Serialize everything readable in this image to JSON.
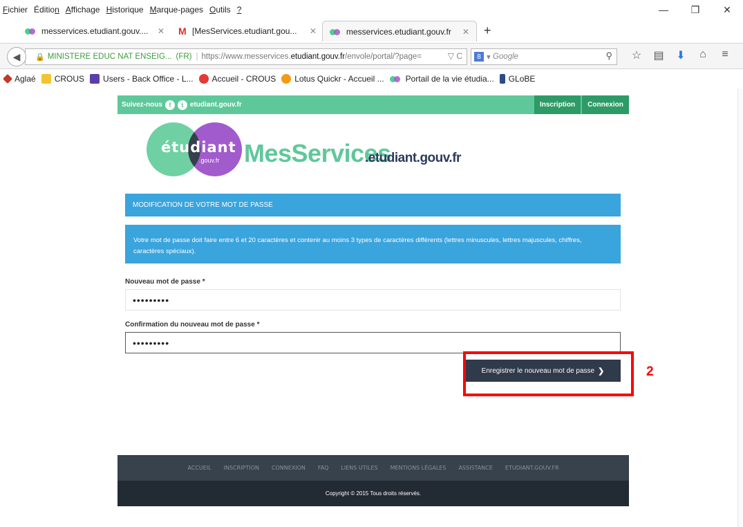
{
  "menu": {
    "items": [
      {
        "accel": "F",
        "rest": "ichier"
      },
      {
        "accel": "",
        "rest": "Éditio",
        "accel2": "n"
      },
      {
        "accel": "A",
        "rest": "ffichage"
      },
      {
        "accel": "H",
        "rest": "istorique"
      },
      {
        "accel": "M",
        "rest": "arque-pages"
      },
      {
        "accel": "O",
        "rest": "utils"
      },
      {
        "accel": "?",
        "rest": ""
      }
    ]
  },
  "window": {
    "minimize": "—",
    "restore": "❐",
    "close": "✕"
  },
  "tabs": [
    {
      "title": "messervices.etudiant.gouv...."
    },
    {
      "title": "[MesServices.etudiant.gou..."
    },
    {
      "title": "messervices.etudiant.gouv.fr"
    }
  ],
  "newtab": "+",
  "urlbar": {
    "org": "MINISTERE EDUC NAT ENSEIG...",
    "country": "(FR)",
    "prefix": "https://www.messervices.",
    "host": "etudiant.gouv.fr",
    "path": "/envole/portal/?page=",
    "end": "▽ C"
  },
  "search": {
    "badge": "8",
    "placeholder": "Google"
  },
  "bookmarks": [
    {
      "label": "Aglaé"
    },
    {
      "label": "CROUS"
    },
    {
      "label": "Users - Back Office - L..."
    },
    {
      "label": "Accueil - CROUS"
    },
    {
      "label": "Lotus Quickr - Accueil ..."
    },
    {
      "label": "Portail de la vie étudia..."
    },
    {
      "label": "GLoBE"
    }
  ],
  "site": {
    "follow": "Suivez-nous",
    "domain": "etudiant.gouv.fr",
    "signup": "Inscription",
    "login": "Connexion",
    "logo_word": "étudiant",
    "logo_sub": ".gouv.fr",
    "brand": "MesServices",
    "brand_domain": ".etudiant.gouv.fr"
  },
  "form": {
    "heading": "MODIFICATION DE VOTRE MOT DE PASSE",
    "info": "Votre mot de passe doit faire entre 6 et 20 caractères et contenir au moins 3 types de caractères différents (lettres minuscules, lettres majuscules, chiffres, caractères spéciaux).",
    "new_label": "Nouveau mot de passe *",
    "new_value": "•••••••••",
    "confirm_label": "Confirmation du nouveau mot de passe *",
    "confirm_value": "•••••••••",
    "submit": "Enregistrer le nouveau mot de passe"
  },
  "footer": {
    "links": [
      "ACCUEIL",
      "INSCRIPTION",
      "CONNEXION",
      "FAQ",
      "LIENS UTILES",
      "MENTIONS LÉGALES",
      "ASSISTANCE",
      "ETUDIANT.GOUV.FR"
    ],
    "copyright": "Copyright © 2015 Tous droits réservés."
  },
  "annotation": {
    "step": "2",
    "color": "#ff0000"
  }
}
